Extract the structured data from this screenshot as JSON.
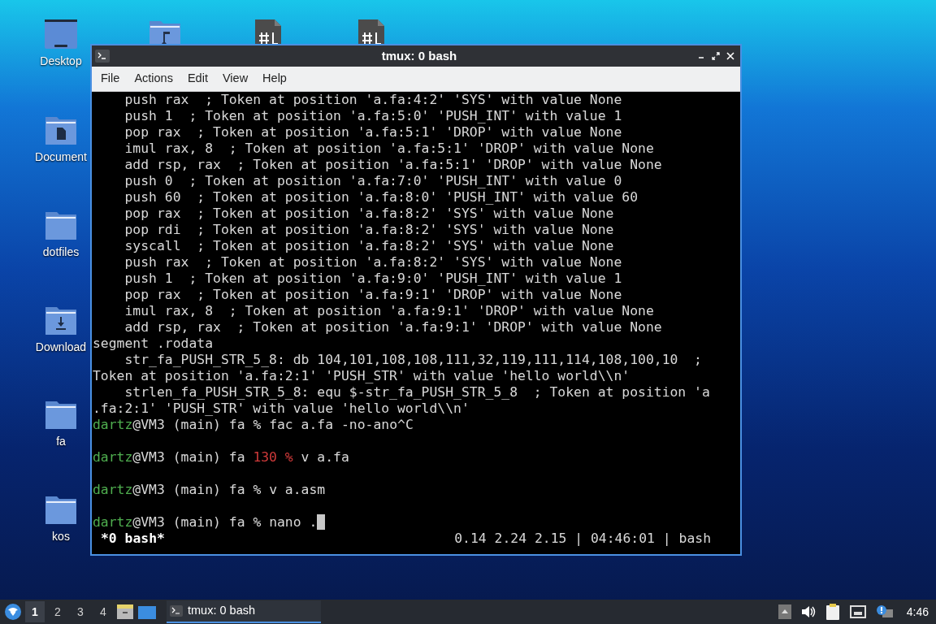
{
  "desktop_icons": [
    {
      "kind": "desktop",
      "label": "Desktop"
    },
    {
      "kind": "music"
    },
    {
      "kind": "script"
    },
    {
      "kind": "script"
    },
    {
      "kind": "documents",
      "label": "Document"
    },
    {
      "kind": "folder",
      "label": "dotfiles"
    },
    {
      "kind": "downloads",
      "label": "Download"
    },
    {
      "kind": "folder",
      "label": "fa"
    },
    {
      "kind": "folder",
      "label": "kos"
    }
  ],
  "window": {
    "title": "tmux: 0 bash",
    "active": true,
    "menu": [
      "File",
      "Actions",
      "Edit",
      "View",
      "Help"
    ],
    "terminal": {
      "lines": [
        {
          "kind": "text",
          "text": "    push rax  ; Token at position 'a.fa:4:2' 'SYS' with value None"
        },
        {
          "kind": "text",
          "text": "    push 1  ; Token at position 'a.fa:5:0' 'PUSH_INT' with value 1"
        },
        {
          "kind": "text",
          "text": "    pop rax  ; Token at position 'a.fa:5:1' 'DROP' with value None"
        },
        {
          "kind": "text",
          "text": "    imul rax, 8  ; Token at position 'a.fa:5:1' 'DROP' with value None"
        },
        {
          "kind": "text",
          "text": "    add rsp, rax  ; Token at position 'a.fa:5:1' 'DROP' with value None"
        },
        {
          "kind": "text",
          "text": "    push 0  ; Token at position 'a.fa:7:0' 'PUSH_INT' with value 0"
        },
        {
          "kind": "text",
          "text": "    push 60  ; Token at position 'a.fa:8:0' 'PUSH_INT' with value 60"
        },
        {
          "kind": "text",
          "text": "    pop rax  ; Token at position 'a.fa:8:2' 'SYS' with value None"
        },
        {
          "kind": "text",
          "text": "    pop rdi  ; Token at position 'a.fa:8:2' 'SYS' with value None"
        },
        {
          "kind": "text",
          "text": "    syscall  ; Token at position 'a.fa:8:2' 'SYS' with value None"
        },
        {
          "kind": "text",
          "text": "    push rax  ; Token at position 'a.fa:8:2' 'SYS' with value None"
        },
        {
          "kind": "text",
          "text": "    push 1  ; Token at position 'a.fa:9:0' 'PUSH_INT' with value 1"
        },
        {
          "kind": "text",
          "text": "    pop rax  ; Token at position 'a.fa:9:1' 'DROP' with value None"
        },
        {
          "kind": "text",
          "text": "    imul rax, 8  ; Token at position 'a.fa:9:1' 'DROP' with value None"
        },
        {
          "kind": "text",
          "text": "    add rsp, rax  ; Token at position 'a.fa:9:1' 'DROP' with value None"
        },
        {
          "kind": "text",
          "text": "segment .rodata"
        },
        {
          "kind": "text",
          "text": "    str_fa_PUSH_STR_5_8: db 104,101,108,108,111,32,119,111,114,108,100,10  ;"
        },
        {
          "kind": "text",
          "text": "Token at position 'a.fa:2:1' 'PUSH_STR' with value 'hello world\\\\n'"
        },
        {
          "kind": "text",
          "text": "    strlen_fa_PUSH_STR_5_8: equ $-str_fa_PUSH_STR_5_8  ; Token at position 'a"
        },
        {
          "kind": "text",
          "text": ".fa:2:1' 'PUSH_STR' with value 'hello world\\\\n'"
        },
        {
          "kind": "prompt",
          "user": "dartz",
          "host": "@VM3 (main) fa",
          "status": "%",
          "error": false,
          "command": "fac a.fa -no-ano^C",
          "cursor": false
        },
        {
          "kind": "blank"
        },
        {
          "kind": "prompt",
          "user": "dartz",
          "host": "@VM3 (main) fa",
          "status": "130 %",
          "error": true,
          "command": "v a.fa",
          "cursor": false
        },
        {
          "kind": "blank"
        },
        {
          "kind": "prompt",
          "user": "dartz",
          "host": "@VM3 (main) fa",
          "status": "%",
          "error": false,
          "command": "v a.asm",
          "cursor": false
        },
        {
          "kind": "blank"
        },
        {
          "kind": "prompt",
          "user": "dartz",
          "host": "@VM3 (main) fa",
          "status": "%",
          "error": false,
          "command": "nano .",
          "cursor": true
        }
      ],
      "status_left": "*0 bash*",
      "status_right": "0.14 2.24 2.15 | 04:46:01 | bash"
    }
  },
  "taskbar": {
    "workspaces": [
      {
        "label": "1",
        "selected": true
      },
      {
        "label": "2",
        "selected": false
      },
      {
        "label": "3",
        "selected": false
      },
      {
        "label": "4",
        "selected": false
      }
    ],
    "tasks": [
      {
        "title": "tmux: 0 bash",
        "selected": true
      }
    ],
    "clock": "4:46"
  }
}
